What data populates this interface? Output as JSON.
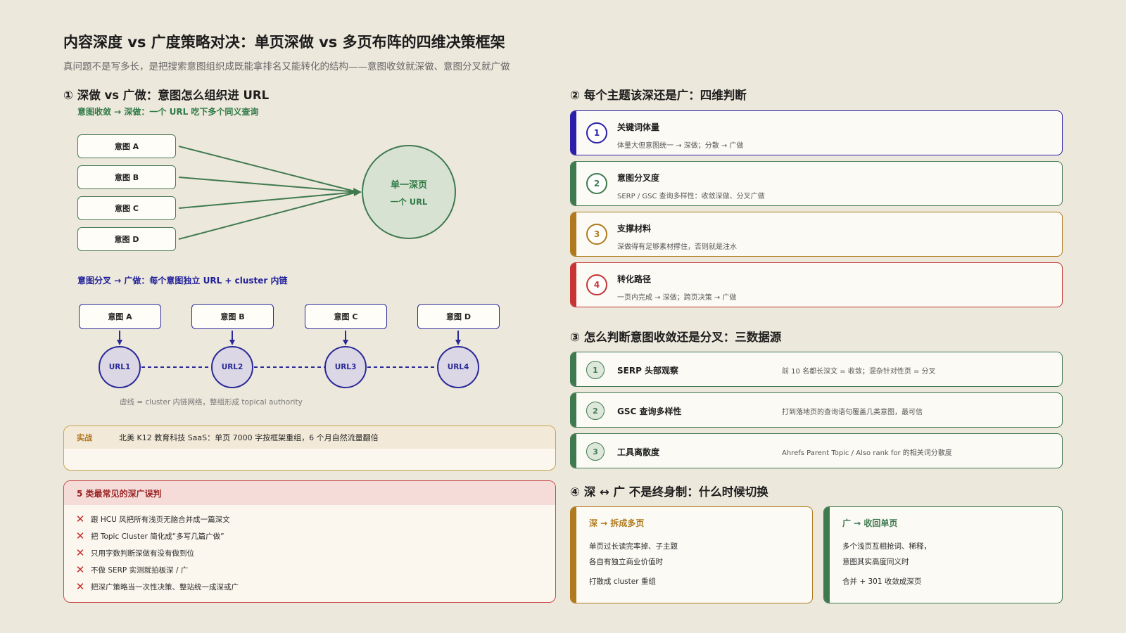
{
  "page": {
    "title": "内容深度 vs 广度策略对决：单页深做 vs 多页布阵的四维决策框架",
    "subtitle": "真问题不是写多长，是把搜索意图组织成既能拿排名又能转化的结构——意图收敛就深做、意图分叉就广做"
  },
  "section1": {
    "title": "① 深做 vs 广做：意图怎么组织进 URL",
    "converge_label": "意图收敛 → 深做：一个 URL 吃下多个同义查询",
    "converge_intents": [
      "意图 A",
      "意图 B",
      "意图 C",
      "意图 D"
    ],
    "single_page_l1": "单一深页",
    "single_page_l2": "一个 URL",
    "diverge_label": "意图分叉 → 广做：每个意图独立 URL + cluster 内链",
    "diverge_intents": [
      "意图 A",
      "意图 B",
      "意图 C",
      "意图 D"
    ],
    "urls": [
      "URL1",
      "URL2",
      "URL3",
      "URL4"
    ],
    "note": "虚线 = cluster 内链网络，整组形成 topical authority"
  },
  "case": {
    "tag": "实战",
    "text": "北美 K12 教育科技 SaaS：单页 7000 字按框架重组，6 个月自然流量翻倍"
  },
  "pitfalls": {
    "title": "5 类最常见的深广误判",
    "items": [
      "跟 HCU 风把所有浅页无脑合并成一篇深文",
      "把 Topic Cluster 简化成“多写几篇广做”",
      "只用字数判断深做有没有做到位",
      "不做 SERP 实测就拍板深 / 广",
      "把深广策略当一次性决策、整站统一成深或广"
    ]
  },
  "section2": {
    "title": "② 每个主题该深还是广：四维判断",
    "items": [
      {
        "num": "1",
        "name": "关键词体量",
        "desc": "体量大但意图统一 → 深做；分散 → 广做",
        "color": "#2a1fa8"
      },
      {
        "num": "2",
        "name": "意图分叉度",
        "desc": "SERP / GSC 查询多样性：收敛深做、分叉广做",
        "color": "#3f7a4f"
      },
      {
        "num": "3",
        "name": "支撑材料",
        "desc": "深做得有足够素材撑住，否则就是注水",
        "color": "#b07a1c"
      },
      {
        "num": "4",
        "name": "转化路径",
        "desc": "一页内完成 → 深做；跨页决策 → 广做",
        "color": "#c63434"
      }
    ]
  },
  "section3": {
    "title": "③ 怎么判断意图收敛还是分叉：三数据源",
    "items": [
      {
        "num": "1",
        "name": "SERP 头部观察",
        "desc": "前 10 名都长深文 = 收敛；混杂针对性页 = 分叉"
      },
      {
        "num": "2",
        "name": "GSC 查询多样性",
        "desc": "打到落地页的查询语句覆盖几类意图，最可信"
      },
      {
        "num": "3",
        "name": "工具离散度",
        "desc": "Ahrefs Parent Topic / Also rank for 的相关词分散度"
      }
    ]
  },
  "section4": {
    "title": "④ 深 ↔ 广 不是终身制：什么时候切换",
    "deep": {
      "head": "深 → 拆成多页",
      "lines": [
        "单页过长读完率掉、子主题",
        "各自有独立商业价值时",
        "打散成 cluster 重组"
      ],
      "color": "#b07a1c"
    },
    "wide": {
      "head": "广 → 收回单页",
      "lines": [
        "多个浅页互相抢词、稀释，",
        "意图其实高度同义时",
        "合并 + 301 收敛成深页"
      ],
      "color": "#3f7a4f"
    }
  }
}
